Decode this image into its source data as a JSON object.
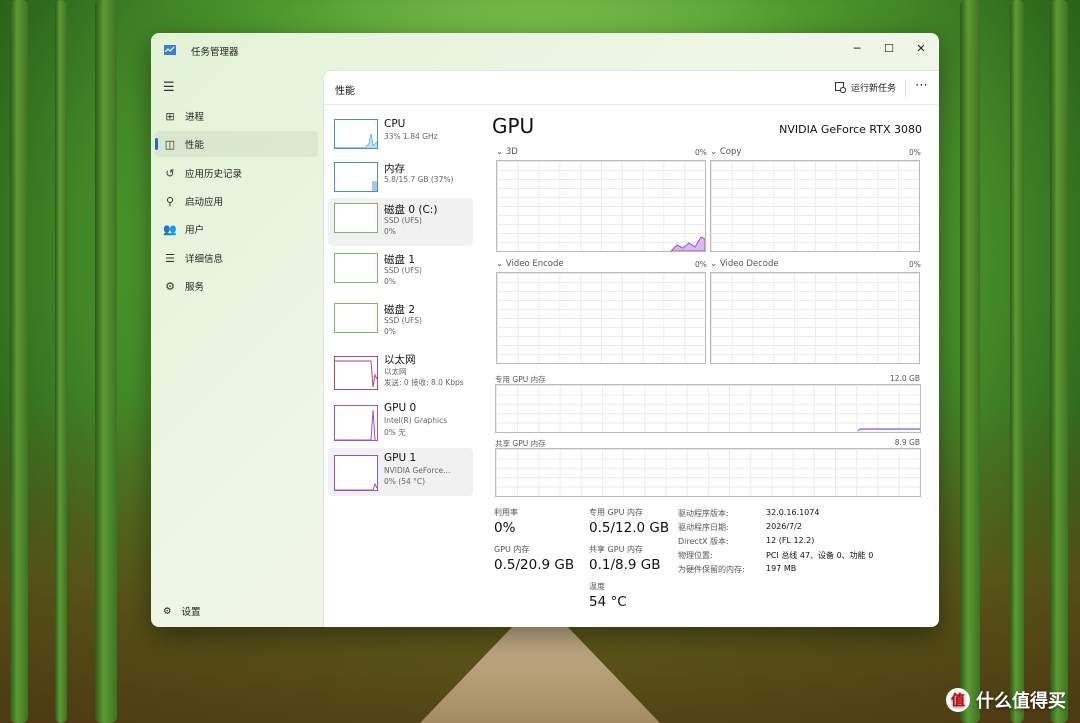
{
  "window": {
    "title": "任务管理器"
  },
  "sidebar": {
    "items": [
      {
        "label": "进程",
        "icon": "processes-icon",
        "glyph": "⊞"
      },
      {
        "label": "性能",
        "icon": "performance-icon",
        "glyph": "◫"
      },
      {
        "label": "应用历史记录",
        "icon": "app-history-icon",
        "glyph": "↺"
      },
      {
        "label": "启动应用",
        "icon": "startup-apps-icon",
        "glyph": "⚲"
      },
      {
        "label": "用户",
        "icon": "users-icon",
        "glyph": "👥"
      },
      {
        "label": "详细信息",
        "icon": "details-icon",
        "glyph": "☰"
      },
      {
        "label": "服务",
        "icon": "services-icon",
        "glyph": "⚙"
      }
    ],
    "settings_label": "设置"
  },
  "header": {
    "title": "性能",
    "run_new_task": "运行新任务"
  },
  "devices": [
    {
      "name": "CPU",
      "sub1": "33%  1.84 GHz",
      "sub2": ""
    },
    {
      "name": "内存",
      "sub1": "5.8/15.7 GB (37%)",
      "sub2": ""
    },
    {
      "name": "磁盘 0 (C:)",
      "sub1": "SSD (UFS)",
      "sub2": "0%"
    },
    {
      "name": "磁盘 1",
      "sub1": "SSD (UFS)",
      "sub2": "0%"
    },
    {
      "name": "磁盘 2",
      "sub1": "SSD (UFS)",
      "sub2": "0%"
    },
    {
      "name": "以太网",
      "sub1": "以太网",
      "sub2": "发送: 0  接收: 8.0 Kbps"
    },
    {
      "name": "GPU 0",
      "sub1": "Intel(R) Graphics",
      "sub2": "0%  无"
    },
    {
      "name": "GPU 1",
      "sub1": "NVIDIA GeForce...",
      "sub2": "0% (54 °C)"
    }
  ],
  "gpu": {
    "title": "GPU",
    "model": "NVIDIA GeForce RTX 3080",
    "engines": [
      {
        "label": "3D",
        "pct": "0%"
      },
      {
        "label": "Copy",
        "pct": "0%"
      },
      {
        "label": "Video Encode",
        "pct": "0%"
      },
      {
        "label": "Video Decode",
        "pct": "0%"
      }
    ],
    "dedicated_label": "专用 GPU 内存",
    "dedicated_max": "12.0 GB",
    "shared_label": "共享 GPU 内存",
    "shared_max": "8.9 GB",
    "stats": {
      "util_label": "利用率",
      "util_value": "0%",
      "ded_label": "专用 GPU 内存",
      "ded_value": "0.5/12.0 GB",
      "gpumem_label": "GPU 内存",
      "gpumem_value": "0.5/20.9 GB",
      "shr_label": "共享 GPU 内存",
      "shr_value": "0.1/8.9 GB",
      "temp_label": "温度",
      "temp_value": "54 °C"
    },
    "info": [
      {
        "k": "驱动程序版本:",
        "v": "32.0.16.1074"
      },
      {
        "k": "驱动程序日期:",
        "v": "2026/7/2"
      },
      {
        "k": "DirectX 版本:",
        "v": "12 (FL 12.2)"
      },
      {
        "k": "物理位置:",
        "v": "PCI 总线 47、设备 0、功能 0"
      },
      {
        "k": "为硬件保留的内存:",
        "v": "197 MB"
      }
    ]
  },
  "watermark": {
    "text": "什么值得买",
    "logo": "值"
  },
  "colors": {
    "accent": "#1e6fc8",
    "gpu_line": "#9b4fd6",
    "net_line": "#b04a6a",
    "cpu_line": "#2a90c8"
  }
}
